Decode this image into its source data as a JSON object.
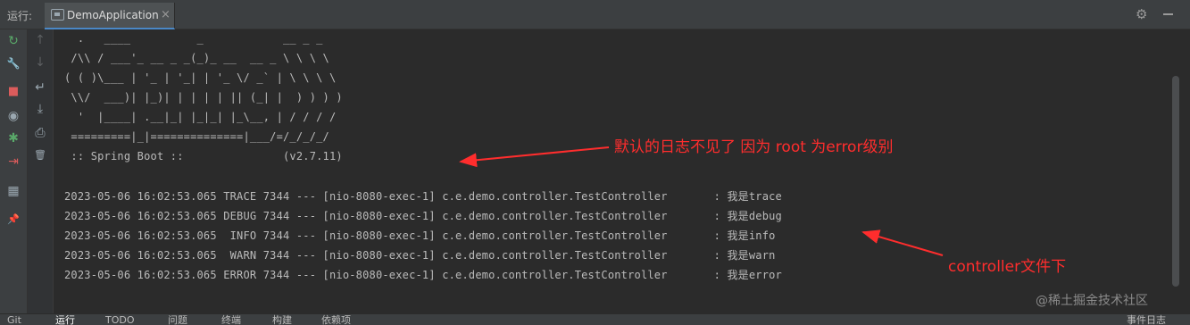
{
  "topbar": {
    "run_label": "运行:",
    "tab_label": "DemoApplication",
    "close_glyph": "×",
    "settings_glyph": "⚙"
  },
  "toolbar": {
    "rerun_glyph": "↻",
    "wrench_glyph": "🔧",
    "stop_glyph": "■",
    "camera_glyph": "◉",
    "bug_glyph": "✱",
    "exit_glyph": "⇥",
    "layout_glyph": "▦",
    "pin_glyph": "📌",
    "up_glyph": "↑",
    "down_glyph": "↓",
    "wrap_glyph": "↵",
    "scroll_end_glyph": "⤓",
    "print_glyph": "⎙",
    "trash_glyph": "🗑"
  },
  "console": {
    "banner": [
      "  .   ____          _            __ _ _",
      " /\\\\ / ___'_ __ _ _(_)_ __  __ _ \\ \\ \\ \\",
      "( ( )\\___ | '_ | '_| | '_ \\/ _` | \\ \\ \\ \\",
      " \\\\/  ___)| |_)| | | | | || (_| |  ) ) ) )",
      "  '  |____| .__|_| |_|_| |_\\__, | / / / /",
      " =========|_|==============|___/=/_/_/_/",
      " :: Spring Boot ::               (v2.7.11)"
    ],
    "logs": [
      "2023-05-06 16:02:53.065 TRACE 7344 --- [nio-8080-exec-1] c.e.demo.controller.TestController       : 我是trace",
      "2023-05-06 16:02:53.065 DEBUG 7344 --- [nio-8080-exec-1] c.e.demo.controller.TestController       : 我是debug",
      "2023-05-06 16:02:53.065  INFO 7344 --- [nio-8080-exec-1] c.e.demo.controller.TestController       : 我是info",
      "2023-05-06 16:02:53.065  WARN 7344 --- [nio-8080-exec-1] c.e.demo.controller.TestController       : 我是warn",
      "2023-05-06 16:02:53.065 ERROR 7344 --- [nio-8080-exec-1] c.e.demo.controller.TestController       : 我是error"
    ]
  },
  "annotations": {
    "note1": "默认的日志不见了 因为 root 为error级别",
    "note2": "controller文件下",
    "color": "#ff2d2d"
  },
  "watermark": "@稀土掘金技术社区",
  "bottombar": {
    "items": [
      "Git",
      "运行",
      "TODO",
      "问题",
      "终端",
      "构建",
      "依赖项"
    ],
    "right": "事件日志"
  }
}
